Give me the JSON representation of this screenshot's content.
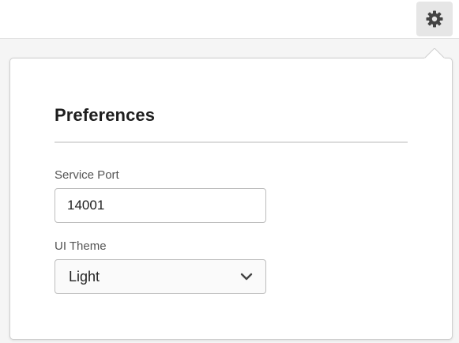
{
  "header": {
    "settings_icon": "gear-icon"
  },
  "preferences": {
    "title": "Preferences",
    "service_port": {
      "label": "Service Port",
      "value": "14001"
    },
    "ui_theme": {
      "label": "UI Theme",
      "selected": "Light",
      "icon": "chevron-down-icon"
    }
  },
  "colors": {
    "background": "#f5f5f5",
    "panel": "#ffffff",
    "border": "#bdbdbd",
    "divider": "#dcdcdc",
    "settings_button": "#e6e6e6",
    "icon": "#444444"
  }
}
